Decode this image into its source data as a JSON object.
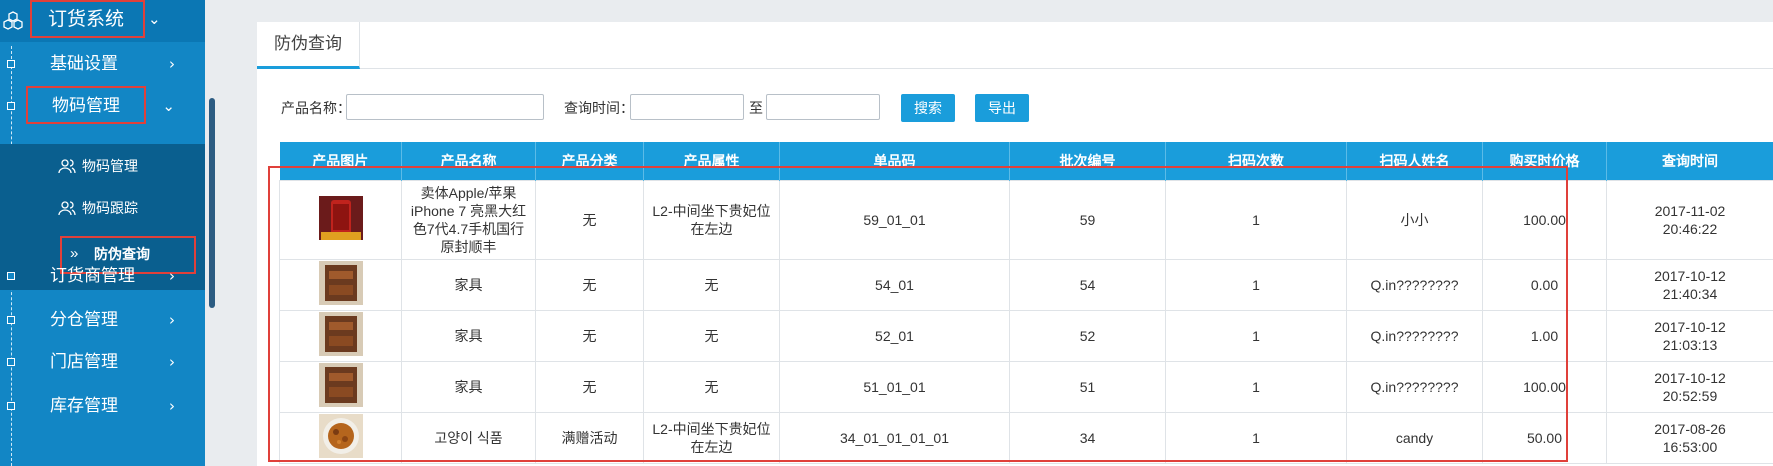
{
  "sidebar": {
    "title": "订货系统",
    "items": [
      {
        "label": "基础设置"
      },
      {
        "label": "物码管理"
      },
      {
        "label": "订货商管理"
      },
      {
        "label": "分仓管理"
      },
      {
        "label": "门店管理"
      },
      {
        "label": "库存管理"
      }
    ],
    "subitems": [
      {
        "label": "物码管理"
      },
      {
        "label": "物码跟踪"
      },
      {
        "label": "防伪查询"
      }
    ]
  },
  "tab": {
    "label": "防伪查询"
  },
  "filters": {
    "product_name_label": "产品名称：",
    "query_time_label": "查询时间：",
    "to_label": "至",
    "search_button": "搜索",
    "export_button": "导出",
    "product_name_value": "",
    "start_time_value": "",
    "end_time_value": ""
  },
  "table": {
    "headers": [
      "产品图片",
      "产品名称",
      "产品分类",
      "产品属性",
      "单品码",
      "批次编号",
      "扫码次数",
      "扫码人姓名",
      "购买时价格",
      "查询时间"
    ],
    "rows": [
      {
        "image": "red-iphone",
        "name": "卖体Apple/苹果 iPhone 7 亮黑大红色7代4.7手机国行原封顺丰",
        "category": "无",
        "attribute": "L2-中间坐下贵妃位在左边",
        "code": "59_01_01",
        "batch": "59",
        "scans": "1",
        "scanner": "小小",
        "price": "100.00",
        "time_date": "2017-11-02",
        "time_clock": "20:46:22"
      },
      {
        "image": "furniture",
        "name": "家具",
        "category": "无",
        "attribute": "无",
        "code": "54_01",
        "batch": "54",
        "scans": "1",
        "scanner": "Q.in????????",
        "price": "0.00",
        "time_date": "2017-10-12",
        "time_clock": "21:40:34"
      },
      {
        "image": "furniture",
        "name": "家具",
        "category": "无",
        "attribute": "无",
        "code": "52_01",
        "batch": "52",
        "scans": "1",
        "scanner": "Q.in????????",
        "price": "1.00",
        "time_date": "2017-10-12",
        "time_clock": "21:03:13"
      },
      {
        "image": "furniture",
        "name": "家具",
        "category": "无",
        "attribute": "无",
        "code": "51_01_01",
        "batch": "51",
        "scans": "1",
        "scanner": "Q.in????????",
        "price": "100.00",
        "time_date": "2017-10-12",
        "time_clock": "20:52:59"
      },
      {
        "image": "food",
        "name": "고양이 식품",
        "category": "满赠活动",
        "attribute": "L2-中间坐下贵妃位在左边",
        "code": "34_01_01_01_01",
        "batch": "34",
        "scans": "1",
        "scanner": "candy",
        "price": "50.00",
        "time_date": "2017-08-26",
        "time_clock": "16:53:00"
      }
    ]
  },
  "colors": {
    "accent": "#1a9ddb",
    "sidebar": "#1286c5",
    "highlight": "#e0403a"
  }
}
